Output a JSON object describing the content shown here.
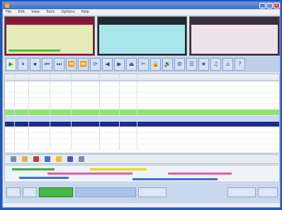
{
  "window": {
    "title": "",
    "controls": [
      "_",
      "□",
      "✕"
    ]
  },
  "menu": [
    "File",
    "Edit",
    "View",
    "Tools",
    "Options",
    "Help"
  ],
  "decks": [
    {
      "header": "",
      "lines": [
        "",
        "",
        "",
        ""
      ],
      "progress": 0.6
    },
    {
      "header": "",
      "lines": [
        "",
        "",
        "",
        ""
      ],
      "progress": 0.0
    },
    {
      "header": "",
      "lines": [
        "",
        "",
        "",
        ""
      ],
      "progress": 0.0
    }
  ],
  "transport": [
    "▶",
    "⏸",
    "⏹",
    "⏮",
    "⏭",
    "⏪",
    "⏩",
    "⟳",
    "◀",
    "▶",
    "⏏",
    "✂",
    "🔒",
    "🔊",
    "⚙",
    "☰",
    "★",
    "♫",
    "⌂",
    "?"
  ],
  "table": {
    "headers": [
      "",
      "",
      "",
      "",
      "",
      "",
      "",
      ""
    ],
    "rows": [
      [
        "",
        "",
        "",
        "",
        "",
        "",
        "",
        ""
      ],
      [
        "",
        "",
        "",
        "",
        "",
        "",
        "",
        ""
      ],
      [
        "",
        "",
        "",
        "",
        "",
        "",
        "",
        ""
      ],
      [
        "",
        "",
        "",
        "",
        "",
        "",
        "",
        ""
      ],
      [
        "",
        "",
        "",
        "",
        "",
        "",
        "",
        ""
      ],
      [
        "",
        "",
        "",
        "",
        "",
        "",
        "",
        ""
      ],
      [
        "",
        "",
        "",
        "",
        "",
        "",
        "",
        ""
      ],
      [
        "",
        "",
        "",
        "",
        "",
        "",
        "",
        ""
      ],
      [
        "",
        "",
        "",
        "",
        "",
        "",
        "",
        ""
      ],
      [
        "",
        "",
        "",
        "",
        "",
        "",
        "",
        ""
      ],
      [
        "",
        "",
        "",
        "",
        "",
        "",
        "",
        ""
      ],
      [
        "",
        "",
        "",
        "",
        "",
        "",
        "",
        ""
      ]
    ],
    "row_styles": [
      "",
      "",
      "",
      "",
      "",
      "green",
      "blue",
      "navy",
      "",
      "",
      "",
      ""
    ]
  },
  "tools": [
    {
      "label": "",
      "icon": "list-icon",
      "color": "#7a8bb0"
    },
    {
      "label": "",
      "icon": "folder-icon",
      "color": "#d9b45a"
    },
    {
      "label": "",
      "icon": "record-icon",
      "color": "#c43a3a"
    },
    {
      "label": "",
      "icon": "diamond-icon",
      "color": "#3a6fd0"
    },
    {
      "label": "",
      "icon": "star-icon",
      "color": "#f0c020"
    },
    {
      "label": "",
      "icon": "diamond-icon",
      "color": "#5a4fb0"
    },
    {
      "label": "",
      "icon": "window-icon",
      "color": "#7a8bb0"
    }
  ],
  "timeline_colors": [
    "#3fae3f",
    "#f0d800",
    "#e85aa6",
    "#3b6fd6"
  ],
  "actions": [
    "",
    "",
    "",
    "",
    "",
    "",
    ""
  ],
  "status": [
    "",
    "",
    "",
    "",
    ""
  ]
}
